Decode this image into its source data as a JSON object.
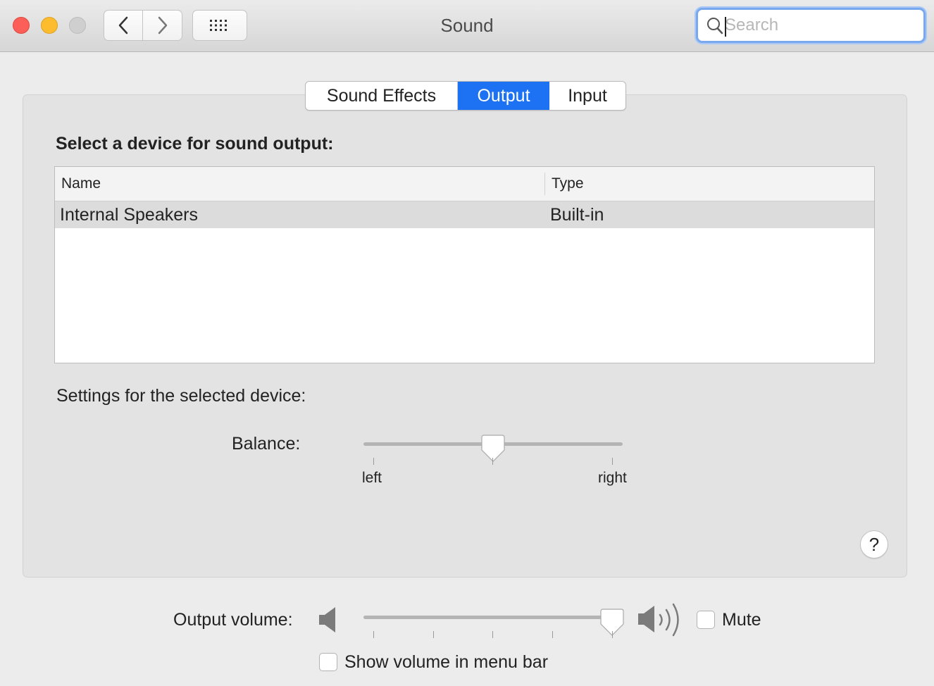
{
  "window": {
    "title": "Sound"
  },
  "search": {
    "placeholder": "Search",
    "value": ""
  },
  "tabs": [
    {
      "label": "Sound Effects",
      "selected": false
    },
    {
      "label": "Output",
      "selected": true
    },
    {
      "label": "Input",
      "selected": false
    }
  ],
  "output": {
    "heading": "Select a device for sound output:",
    "columns": [
      "Name",
      "Type"
    ],
    "devices": [
      {
        "name": "Internal Speakers",
        "type": "Built-in",
        "selected": true
      }
    ],
    "settings_label": "Settings for the selected device:",
    "balance": {
      "label": "Balance:",
      "left_label": "left",
      "right_label": "right",
      "value": 0.5
    }
  },
  "help_label": "?",
  "volume": {
    "label": "Output volume:",
    "value": 1.0,
    "mute_label": "Mute",
    "muted": false
  },
  "menu_bar_checkbox": {
    "label": "Show volume in menu bar",
    "checked": false
  },
  "colors": {
    "accent": "#1d72f3",
    "close": "#fc5f57",
    "minimize": "#fdbc2e",
    "zoom_disabled": "#cfcfcf"
  },
  "icons": {
    "back": "chevron-left-icon",
    "forward": "chevron-right-icon",
    "show_all": "grid-icon",
    "search": "magnifier-icon",
    "volume_low": "speaker-icon",
    "volume_high": "speaker-waves-icon"
  }
}
